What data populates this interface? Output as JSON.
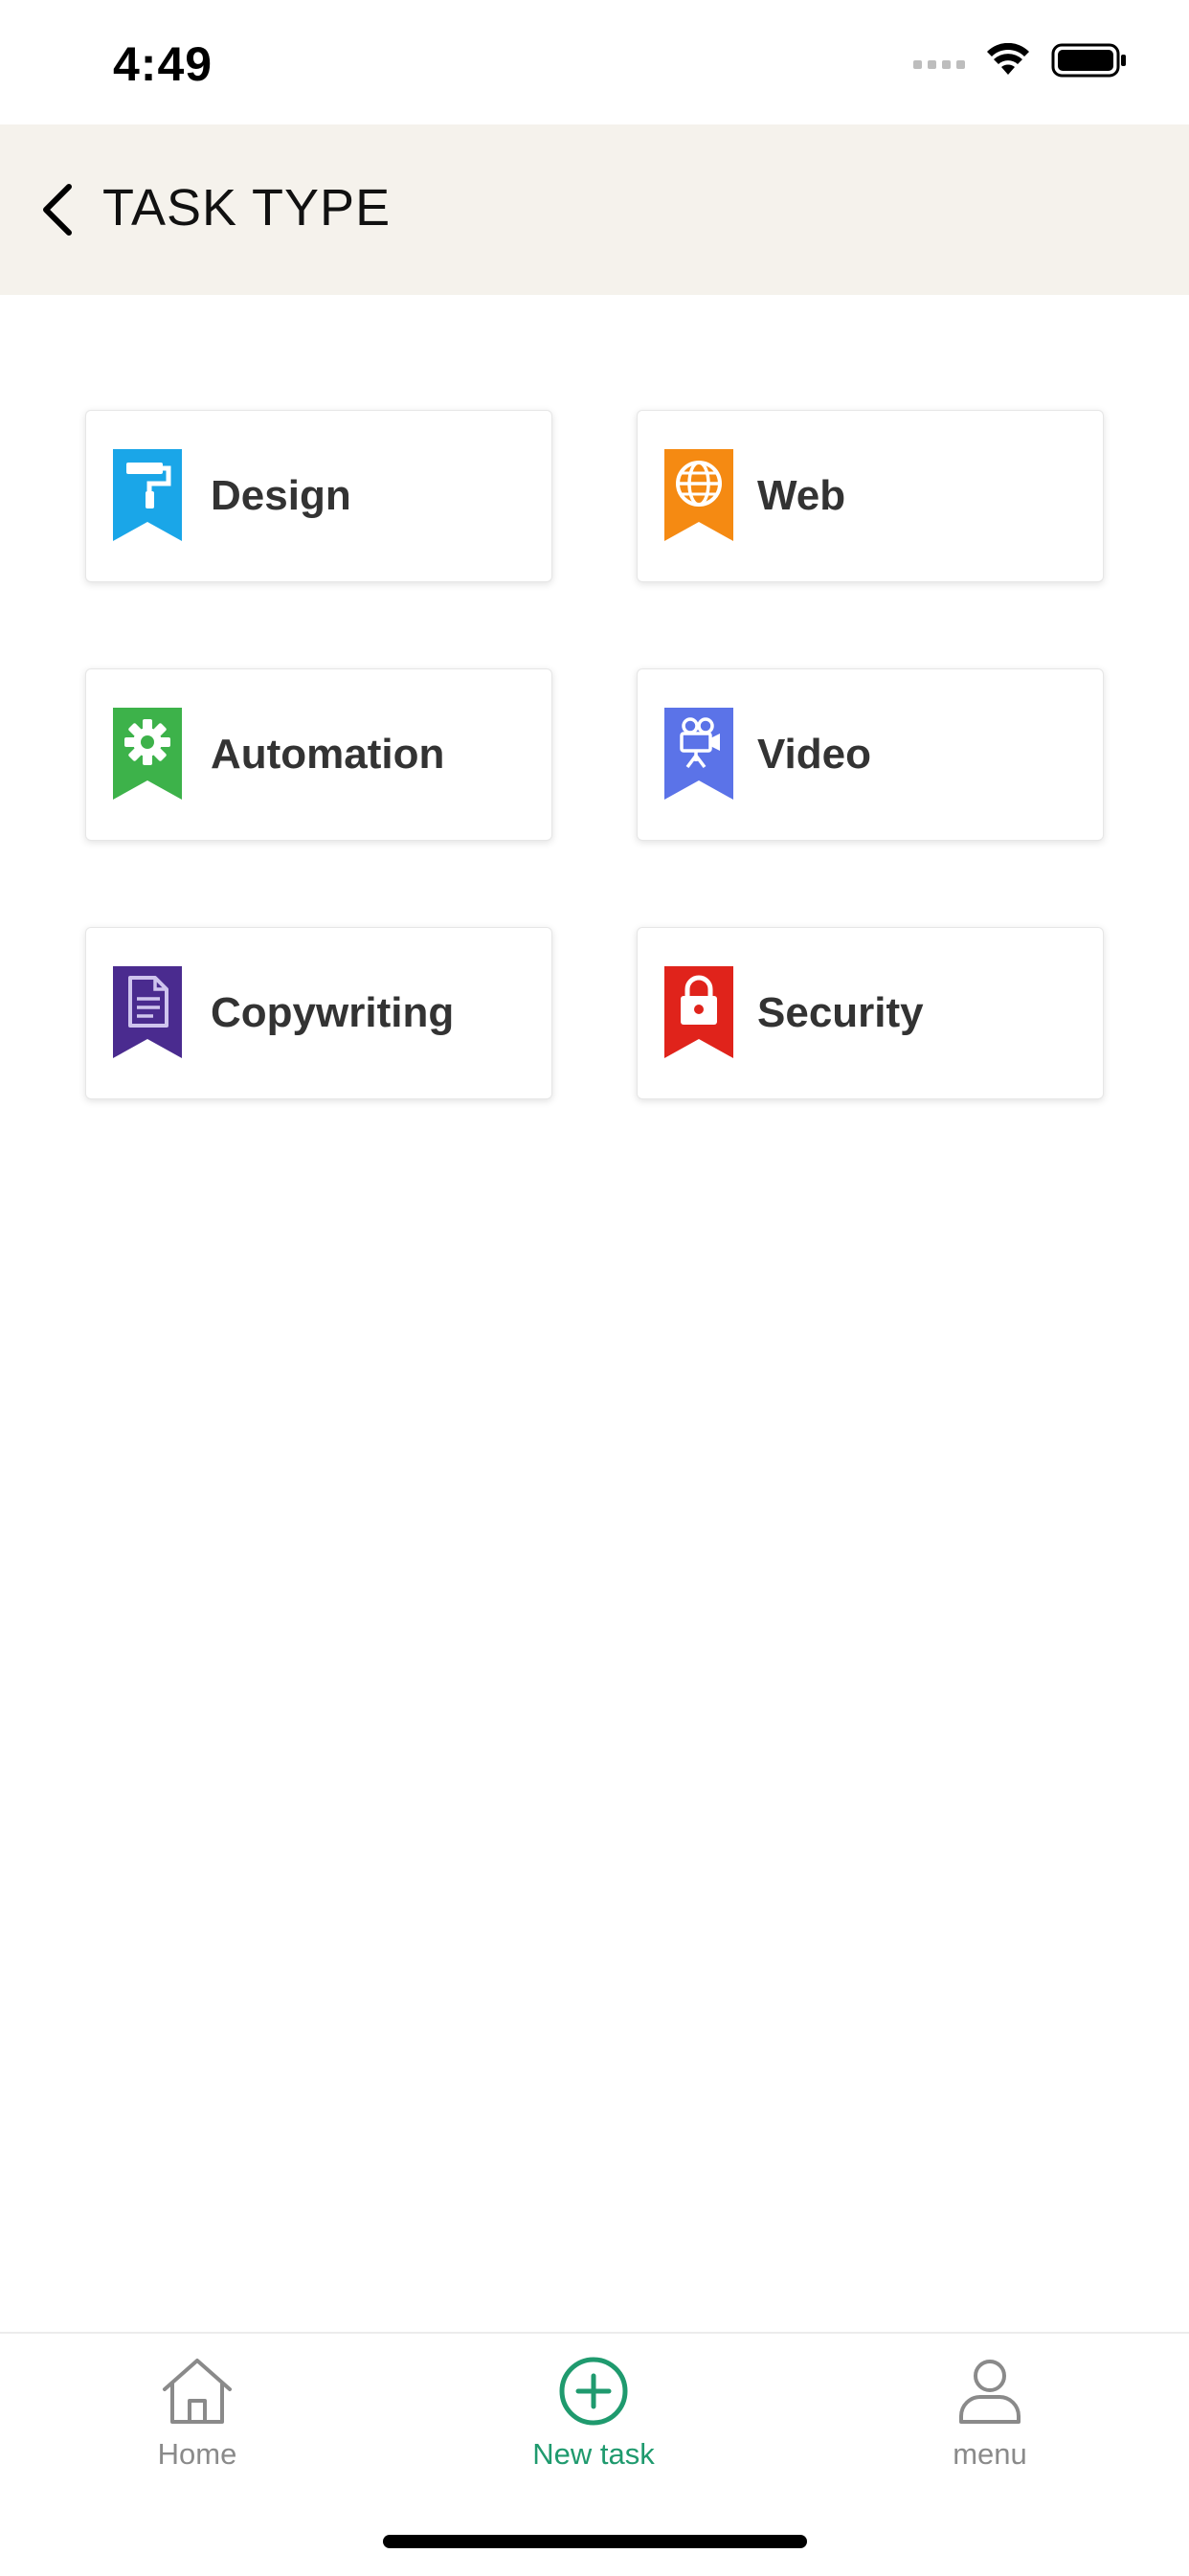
{
  "status_bar": {
    "time": "4:49"
  },
  "header": {
    "title": "TASK TYPE",
    "back_icon": "chevron-left-icon"
  },
  "task_types": [
    {
      "label": "Design",
      "icon": "paint-roller-icon",
      "color": "#1aa6e8"
    },
    {
      "label": "Web",
      "icon": "globe-icon",
      "color": "#f58a12"
    },
    {
      "label": "Automation",
      "icon": "gear-icon",
      "color": "#3db24a"
    },
    {
      "label": "Video",
      "icon": "video-camera-icon",
      "color": "#5b73e8"
    },
    {
      "label": "Copywriting",
      "icon": "document-icon",
      "color": "#4a2b8f"
    },
    {
      "label": "Security",
      "icon": "padlock-icon",
      "color": "#e0231b"
    }
  ],
  "tab_bar": {
    "items": [
      {
        "label": "Home",
        "icon": "home-icon"
      },
      {
        "label": "New task",
        "icon": "plus-circle-icon"
      },
      {
        "label": "menu",
        "icon": "user-icon"
      }
    ],
    "active_color": "#1f9a6e",
    "inactive_color": "#8a8a8a"
  }
}
